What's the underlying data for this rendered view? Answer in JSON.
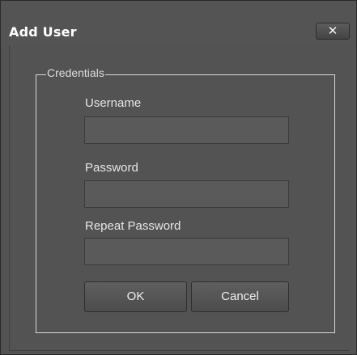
{
  "dialog": {
    "title": "Add User",
    "close_label": "✕"
  },
  "credentials": {
    "legend": "Credentials",
    "username": {
      "label": "Username",
      "value": "",
      "placeholder": ""
    },
    "password": {
      "label": "Password",
      "value": "",
      "placeholder": ""
    },
    "repeat_password": {
      "label": "Repeat Password",
      "value": "",
      "placeholder": ""
    }
  },
  "buttons": {
    "ok": "OK",
    "cancel": "Cancel"
  },
  "icons": {
    "close": "close-icon"
  }
}
